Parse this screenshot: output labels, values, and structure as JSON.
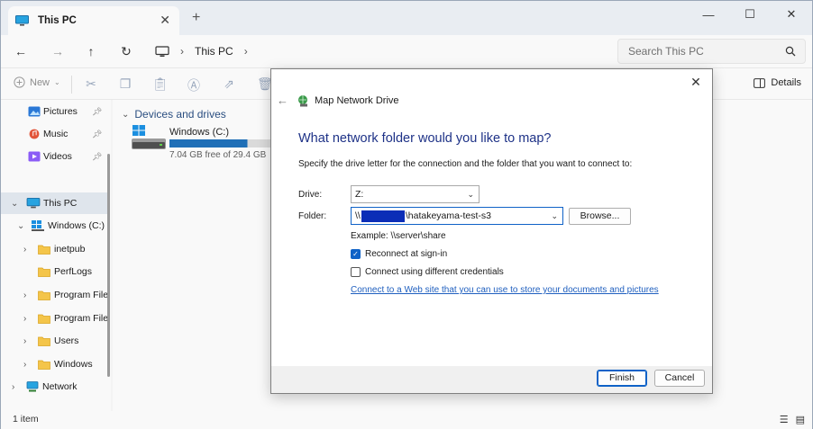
{
  "titlebar": {
    "tab_title": "This PC",
    "new_tab": "+",
    "close_tab": "✕",
    "minimize": "—",
    "maximize": "☐",
    "close": "✕"
  },
  "address": {
    "breadcrumb": [
      "This PC"
    ],
    "search_placeholder": "Search This PC"
  },
  "commandbar": {
    "new_label": "New",
    "details_label": "Details"
  },
  "sidebar": {
    "items": [
      {
        "label": "Pictures",
        "icon": "pictures-icon",
        "pinned": true
      },
      {
        "label": "Music",
        "icon": "music-icon",
        "pinned": true
      },
      {
        "label": "Videos",
        "icon": "videos-icon",
        "pinned": true
      },
      {
        "label": "This PC",
        "icon": "computer-icon",
        "selected": true,
        "expanded": true
      },
      {
        "label": "Windows (C:)",
        "icon": "drive-icon",
        "expanded": true
      },
      {
        "label": "inetpub",
        "icon": "folder-icon"
      },
      {
        "label": "PerfLogs",
        "icon": "folder-icon"
      },
      {
        "label": "Program File",
        "icon": "folder-icon"
      },
      {
        "label": "Program File",
        "icon": "folder-icon"
      },
      {
        "label": "Users",
        "icon": "folder-icon"
      },
      {
        "label": "Windows",
        "icon": "folder-icon"
      },
      {
        "label": "Network",
        "icon": "network-icon"
      }
    ]
  },
  "content": {
    "group_label": "Devices and drives",
    "drive_name": "Windows (C:)",
    "drive_free": "7.04 GB free of 29.4 GB",
    "drive_used_fraction": 0.76
  },
  "status": {
    "item_count": "1 item"
  },
  "dialog": {
    "title": "Map Network Drive",
    "heading": "What network folder would you like to map?",
    "instruction": "Specify the drive letter for the connection and the folder that you want to connect to:",
    "drive_label": "Drive:",
    "drive_value": "Z:",
    "folder_label": "Folder:",
    "folder_prefix": "\\\\",
    "folder_suffix": "\\hatakeyama-test-s3",
    "browse_label": "Browse...",
    "example": "Example: \\\\server\\share",
    "reconnect_label": "Reconnect at sign-in",
    "reconnect_checked": true,
    "credentials_label": "Connect using different credentials",
    "credentials_checked": false,
    "link_text": "Connect to a Web site that you can use to store your documents and pictures",
    "finish_label": "Finish",
    "cancel_label": "Cancel"
  },
  "colors": {
    "accent": "#0f62c7",
    "heading_blue": "#1e3287",
    "drive_bar": "#1f6fb7",
    "folder_yellow": "#f4c54a"
  }
}
